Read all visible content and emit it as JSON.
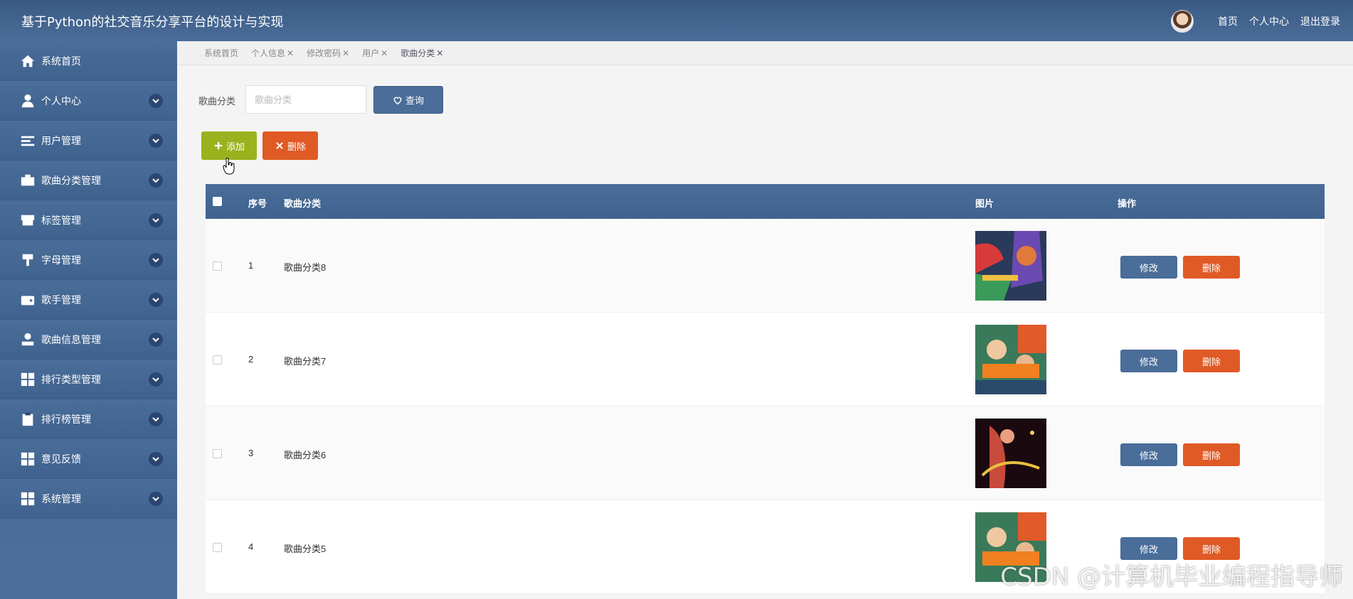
{
  "header": {
    "title": "基于Python的社交音乐分享平台的设计与实现",
    "links": [
      "首页",
      "个人中心",
      "退出登录"
    ]
  },
  "sidebar": {
    "items": [
      {
        "label": "系统首页",
        "icon": "home-icon"
      },
      {
        "label": "个人中心",
        "icon": "user-icon"
      },
      {
        "label": "用户管理",
        "icon": "list-icon"
      },
      {
        "label": "歌曲分类管理",
        "icon": "briefcase-icon"
      },
      {
        "label": "标签管理",
        "icon": "store-icon"
      },
      {
        "label": "字母管理",
        "icon": "brush-icon"
      },
      {
        "label": "歌手管理",
        "icon": "wallet-icon"
      },
      {
        "label": "歌曲信息管理",
        "icon": "user-card-icon"
      },
      {
        "label": "排行类型管理",
        "icon": "grid-icon"
      },
      {
        "label": "排行榜管理",
        "icon": "clipboard-icon"
      },
      {
        "label": "意见反馈",
        "icon": "grid-icon"
      },
      {
        "label": "系统管理",
        "icon": "grid-icon"
      }
    ]
  },
  "tabs": [
    {
      "label": "系统首页",
      "closable": false
    },
    {
      "label": "个人信息",
      "closable": true
    },
    {
      "label": "修改密码",
      "closable": true
    },
    {
      "label": "用户",
      "closable": true
    },
    {
      "label": "歌曲分类",
      "closable": true
    }
  ],
  "search": {
    "label": "歌曲分类",
    "placeholder": "歌曲分类",
    "button": "查询"
  },
  "actions": {
    "add": "添加",
    "delete": "删除"
  },
  "table": {
    "columns": [
      "序号",
      "歌曲分类",
      "图片",
      "操作"
    ],
    "rows": [
      {
        "index": "1",
        "category": "歌曲分类8"
      },
      {
        "index": "2",
        "category": "歌曲分类7"
      },
      {
        "index": "3",
        "category": "歌曲分类6"
      },
      {
        "index": "4",
        "category": "歌曲分类5"
      }
    ],
    "edit_label": "修改",
    "delete_label": "删除"
  },
  "watermark": "CSDN @计算机毕业编程指导师",
  "colors": {
    "header": "#4a6d99",
    "add": "#9ab21e",
    "delete": "#e05a25"
  }
}
